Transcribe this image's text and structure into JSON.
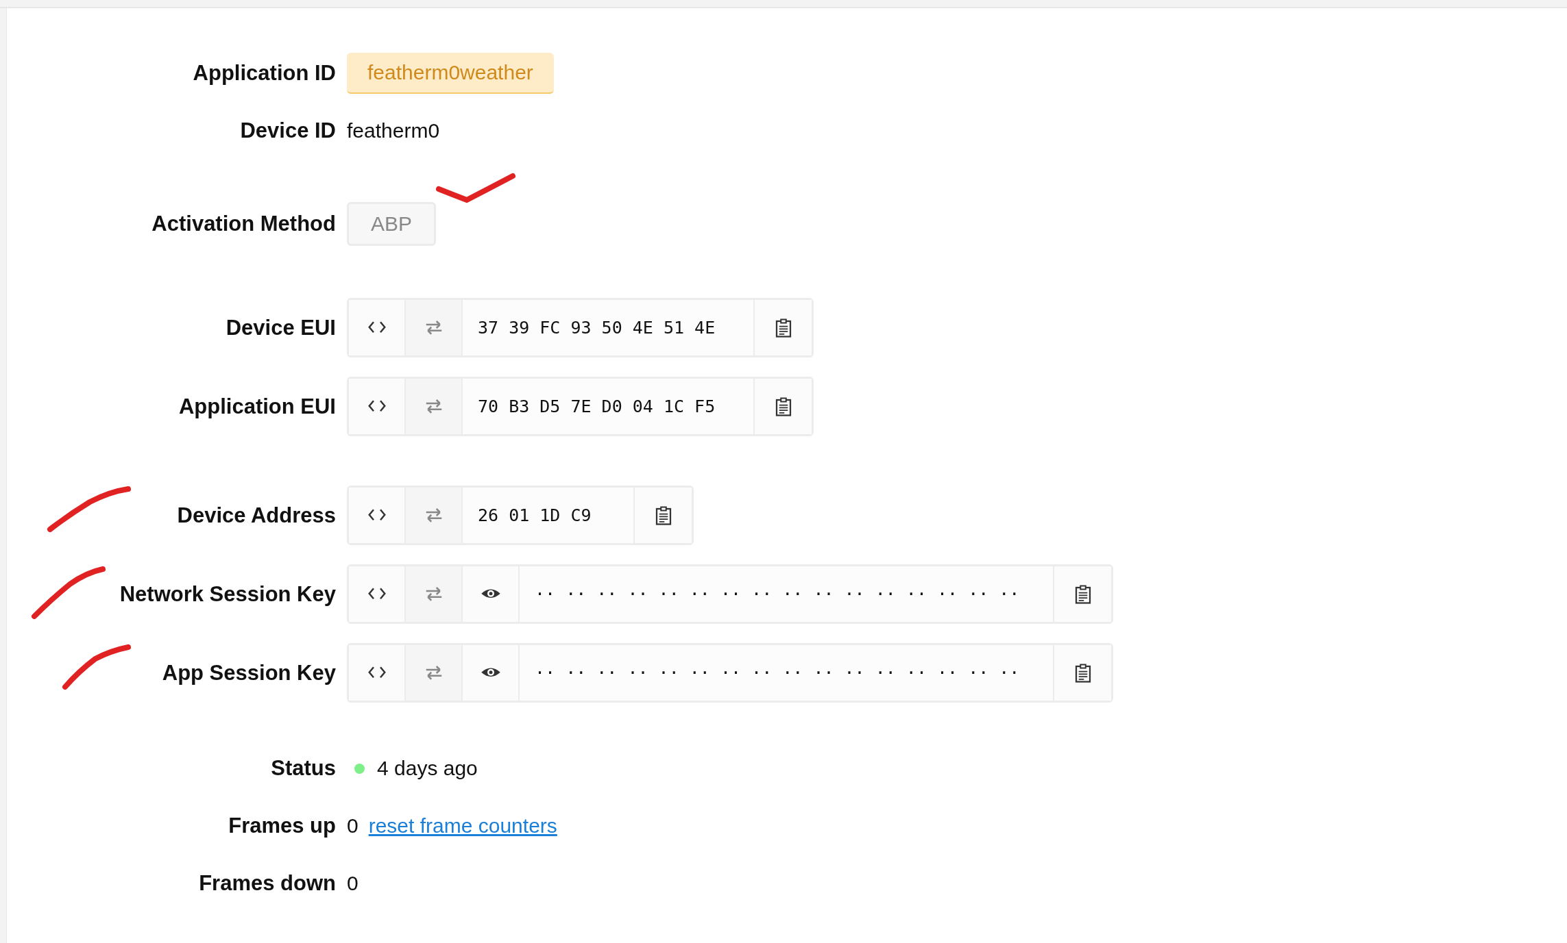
{
  "sections": [
    {
      "rows": [
        {
          "label": "Application ID",
          "kind": "badge",
          "value": "featherm0weather"
        },
        {
          "label": "Device ID",
          "kind": "text",
          "value": "featherm0"
        }
      ]
    },
    {
      "rows": [
        {
          "label": "Activation Method",
          "kind": "tag",
          "value": "ABP"
        }
      ]
    },
    {
      "rows": [
        {
          "label": "Device EUI",
          "kind": "hex",
          "value": "37 39 FC 93 50 4E 51 4E"
        },
        {
          "label": "Application EUI",
          "kind": "hex",
          "value": "70 B3 D5 7E D0 04 1C F5"
        }
      ]
    },
    {
      "rows": [
        {
          "label": "Device Address",
          "kind": "hex",
          "value": "26 01 1D C9"
        },
        {
          "label": "Network Session Key",
          "kind": "secret",
          "value": "·· ·· ·· ·· ·· ·· ·· ·· ·· ·· ·· ·· ·· ·· ·· ··"
        },
        {
          "label": "App Session Key",
          "kind": "secret",
          "value": "·· ·· ·· ·· ·· ·· ·· ·· ·· ·· ·· ·· ·· ·· ·· ··"
        }
      ]
    },
    {
      "rows": [
        {
          "label": "Status",
          "kind": "status",
          "value": "4 days ago",
          "color": "#7ef08a"
        },
        {
          "label": "Frames up",
          "kind": "counter",
          "value": "0",
          "link": "reset frame counters"
        },
        {
          "label": "Frames down",
          "kind": "counter",
          "value": "0"
        }
      ]
    }
  ]
}
